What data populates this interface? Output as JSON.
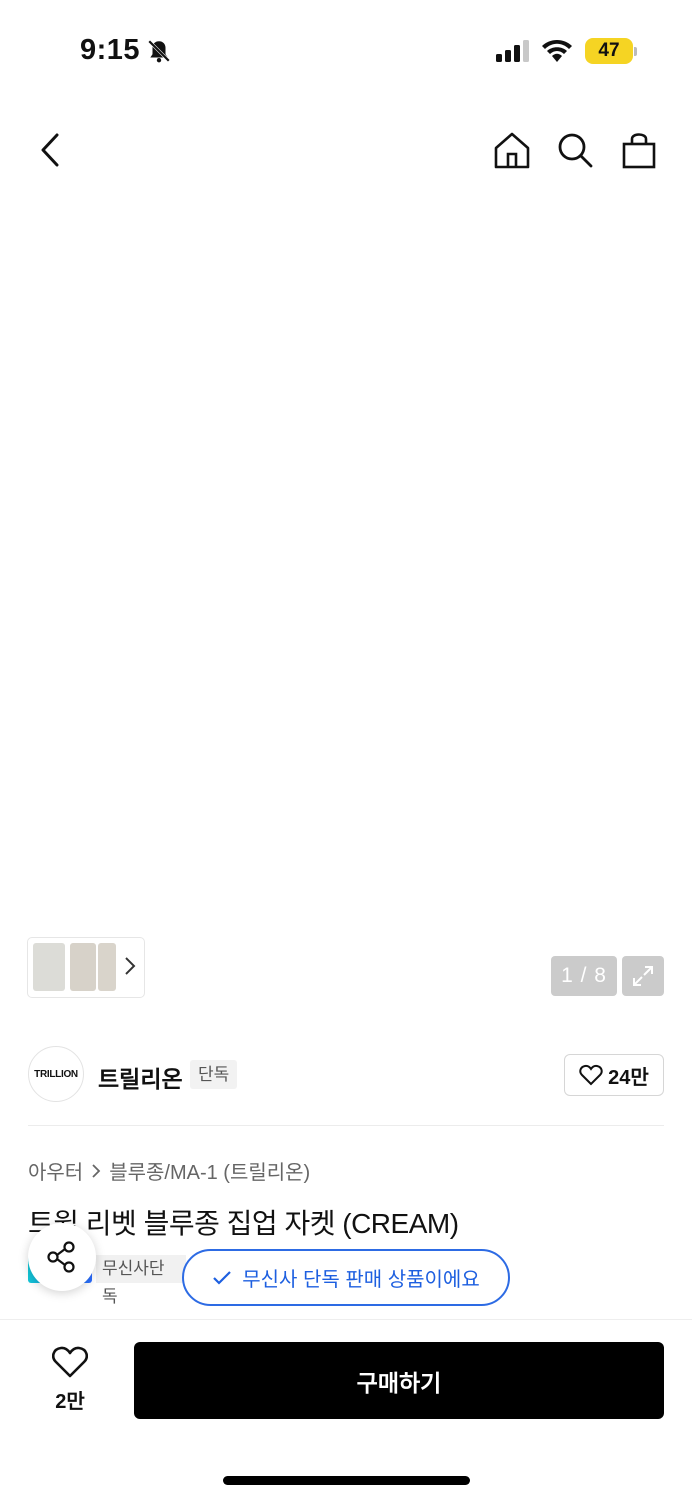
{
  "status_bar": {
    "time": "9:15",
    "battery": "47"
  },
  "nav": {
    "back_icon": "chevron-left-icon",
    "home_icon": "home-icon",
    "search_icon": "search-icon",
    "cart_icon": "shopping-bag-icon"
  },
  "gallery": {
    "counter": "1 / 8",
    "expand_icon": "expand-icon"
  },
  "brand": {
    "logo_text": "TRILLION",
    "name": "트릴리온",
    "badge": "단독",
    "likes": "24만"
  },
  "breadcrumb": {
    "category": "아우터",
    "subcategory": "블루종/MA-1 (트릴리온)"
  },
  "product": {
    "title": "트윌 리벳 블루종 집업 자켓 (CREAM)",
    "exclusive_label": "무신사단독"
  },
  "toast": {
    "message": "무신사 단독 판매 상품이에요"
  },
  "bottom": {
    "wish_count": "2만",
    "buy_label": "구매하기"
  },
  "colors": {
    "accent_blue": "#2d6be4",
    "battery_yellow": "#f5d423",
    "buy_button": "#000000"
  }
}
